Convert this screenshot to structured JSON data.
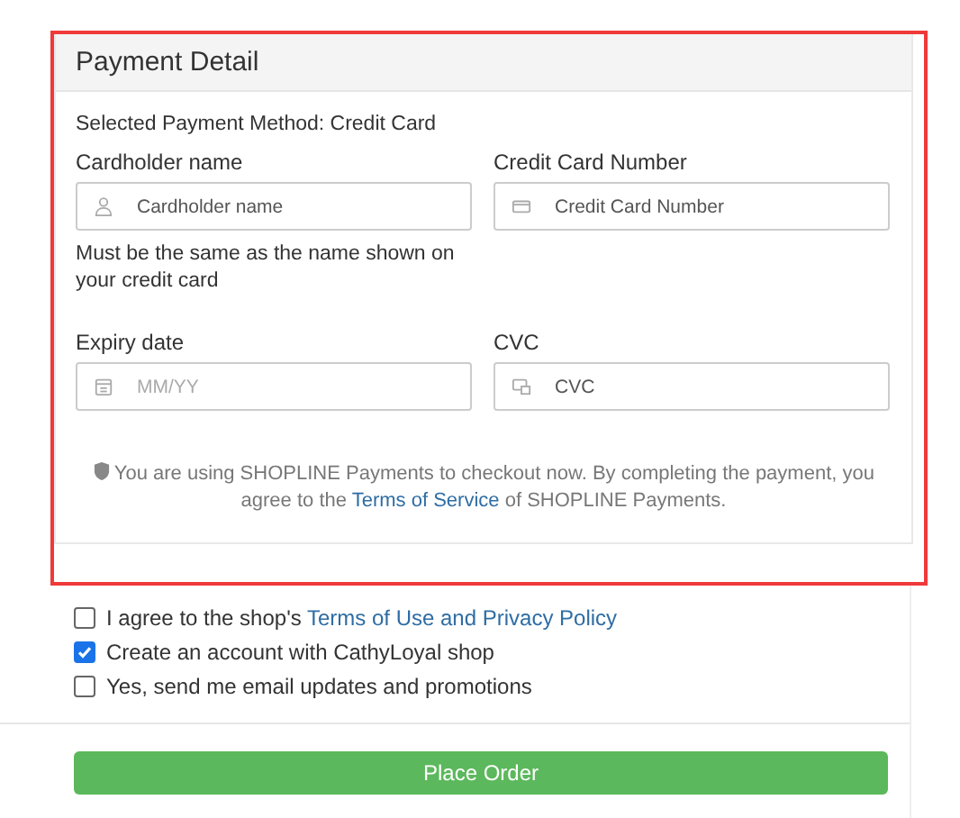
{
  "panel": {
    "title": "Payment Detail",
    "method": "Selected Payment Method: Credit Card",
    "fields": [
      {
        "label": "Cardholder name",
        "placeholder": "Cardholder name",
        "kind": "person",
        "hint": "Must be the same as the name shown on your credit card"
      },
      {
        "label": "Credit Card Number",
        "placeholder": "Credit Card Number",
        "kind": "card"
      },
      {
        "label": "Expiry date",
        "placeholder": "MM/YY",
        "kind": "calendar"
      },
      {
        "label": "CVC",
        "placeholder": "CVC",
        "kind": "cvc"
      }
    ],
    "notice": {
      "before": "You are using SHOPLINE Payments to checkout now. By completing the payment, you agree to the",
      "link": "Terms of Service",
      "after": "of SHOPLINE Payments."
    }
  },
  "checkboxes": [
    {
      "text": "I agree to the shop's",
      "link": "Terms of Use and Privacy Policy",
      "checked": false
    },
    {
      "text": "Create an account with CathyLoyal shop",
      "checked": true
    },
    {
      "text": "Yes, send me email updates and promotions",
      "checked": false
    }
  ],
  "button": "Place Order"
}
